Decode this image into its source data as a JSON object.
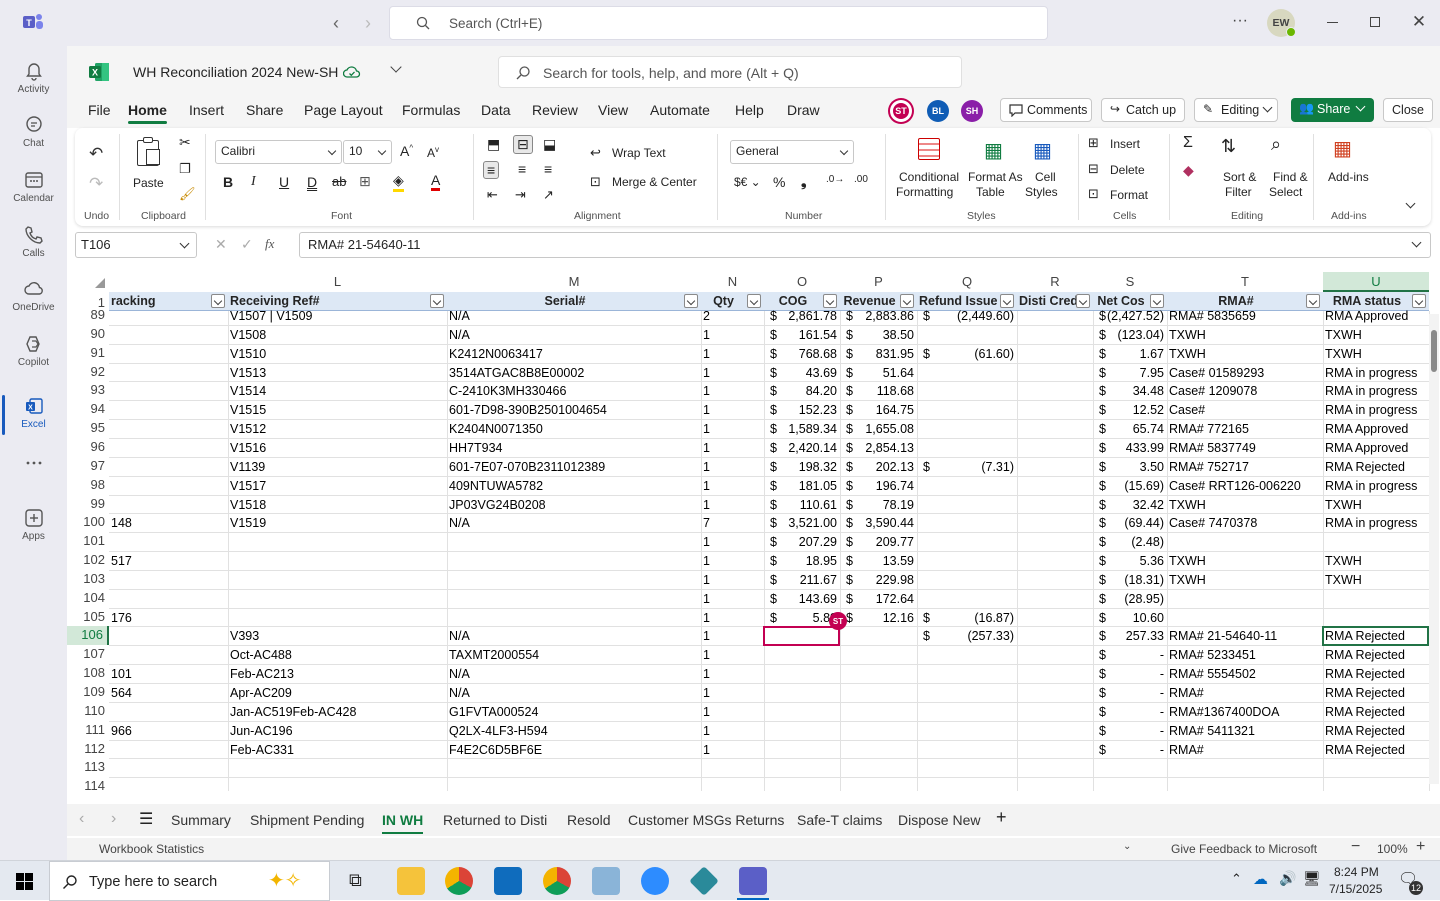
{
  "top": {
    "search_placeholder": "Search (Ctrl+E)",
    "user_initials": "EW"
  },
  "rail": [
    {
      "label": "Activity",
      "icon": "bell-icon"
    },
    {
      "label": "Chat",
      "icon": "chat-icon"
    },
    {
      "label": "Calendar",
      "icon": "calendar-icon"
    },
    {
      "label": "Calls",
      "icon": "phone-icon"
    },
    {
      "label": "OneDrive",
      "icon": "cloud-icon"
    },
    {
      "label": "Copilot",
      "icon": "copilot-icon"
    },
    {
      "label": "Excel",
      "icon": "excel-icon"
    },
    {
      "label": "",
      "icon": "more-icon"
    },
    {
      "label": "Apps",
      "icon": "add-app-icon"
    }
  ],
  "title": {
    "workbook": "WH Reconciliation 2024 New-SH",
    "search_placeholder": "Search for tools, help, and more (Alt + Q)"
  },
  "menu": [
    "File",
    "Home",
    "Insert",
    "Share",
    "Page Layout",
    "Formulas",
    "Data",
    "Review",
    "View",
    "Automate",
    "Help",
    "Draw"
  ],
  "collab": [
    "ST",
    "BL",
    "SH"
  ],
  "actions": {
    "comments": "Comments",
    "catchup": "Catch up",
    "editing": "Editing",
    "share": "Share",
    "close": "Close"
  },
  "ribbon": {
    "undo": "Undo",
    "paste": "Paste",
    "clipboard": "Clipboard",
    "font_name": "Calibri",
    "font_size": "10",
    "font": "Font",
    "wrap": "Wrap Text",
    "merge": "Merge & Center",
    "alignment": "Alignment",
    "number_format": "General",
    "number": "Number",
    "cond": "Conditional",
    "cond2": "Formatting",
    "fmt_table": "Format As",
    "fmt_table2": "Table",
    "cell_styles": "Cell",
    "cell_styles2": "Styles",
    "styles": "Styles",
    "insert": "Insert",
    "delete": "Delete",
    "format": "Format",
    "cells": "Cells",
    "sort": "Sort &",
    "sort2": "Filter",
    "find": "Find &",
    "find2": "Select",
    "editing": "Editing",
    "addins": "Add-ins",
    "addins2": "Add-ins"
  },
  "formula": {
    "name_box": "T106",
    "content": "RMA# 21-54640-11"
  },
  "columns": [
    {
      "letter": "",
      "header": "racking"
    },
    {
      "letter": "L",
      "header": "Receiving Ref#"
    },
    {
      "letter": "M",
      "header": "Serial#"
    },
    {
      "letter": "N",
      "header": "Qty"
    },
    {
      "letter": "O",
      "header": "COG"
    },
    {
      "letter": "P",
      "header": "Revenue"
    },
    {
      "letter": "Q",
      "header": "Refund Issue"
    },
    {
      "letter": "R",
      "header": "Disti Cred"
    },
    {
      "letter": "S",
      "header": "Net Cos"
    },
    {
      "letter": "T",
      "header": "RMA#"
    },
    {
      "letter": "U",
      "header": "RMA status"
    }
  ],
  "rows": [
    {
      "n": "89",
      "k": "",
      "l": "V1507 | V1509",
      "m": "N/A",
      "q": "2",
      "o": "2,861.78",
      "p": "2,883.86",
      "r": "(2,449.60)",
      "s": "(2,427.52)",
      "t": "RMA# 5835659",
      "u": "RMA Approved"
    },
    {
      "n": "90",
      "k": "",
      "l": "V1508",
      "m": "N/A",
      "q": "1",
      "o": "161.54",
      "p": "38.50",
      "r": "",
      "s": "(123.04)",
      "t": "TXWH",
      "u": "TXWH"
    },
    {
      "n": "91",
      "k": "",
      "l": "V1510",
      "m": "K2412N0063417",
      "q": "1",
      "o": "768.68",
      "p": "831.95",
      "r": "(61.60)",
      "s": "1.67",
      "t": "TXWH",
      "u": "TXWH"
    },
    {
      "n": "92",
      "k": "",
      "l": "V1513",
      "m": "3514ATGAC8B8E00002",
      "q": "1",
      "o": "43.69",
      "p": "51.64",
      "r": "",
      "s": "7.95",
      "t": "Case# 01589293",
      "u": "RMA in progress"
    },
    {
      "n": "93",
      "k": "",
      "l": "V1514",
      "m": "C-2410K3MH330466",
      "q": "1",
      "o": "84.20",
      "p": "118.68",
      "r": "",
      "s": "34.48",
      "t": "Case# 1209078",
      "u": "RMA in progress"
    },
    {
      "n": "94",
      "k": "",
      "l": "V1515",
      "m": "601-7D98-390B2501004654",
      "q": "1",
      "o": "152.23",
      "p": "164.75",
      "r": "",
      "s": "12.52",
      "t": "Case#",
      "u": "RMA in progress"
    },
    {
      "n": "95",
      "k": "",
      "l": "V1512",
      "m": "K2404N0071350",
      "q": "1",
      "o": "1,589.34",
      "p": "1,655.08",
      "r": "",
      "s": "65.74",
      "t": "RMA# 772165",
      "u": "RMA Approved"
    },
    {
      "n": "96",
      "k": "",
      "l": "V1516",
      "m": "HH7T934",
      "q": "1",
      "o": "2,420.14",
      "p": "2,854.13",
      "r": "",
      "s": "433.99",
      "t": "RMA# 5837749",
      "u": "RMA Approved"
    },
    {
      "n": "97",
      "k": "",
      "l": "V1139",
      "m": "601-7E07-070B2311012389",
      "q": "1",
      "o": "198.32",
      "p": "202.13",
      "r": "(7.31)",
      "s": "3.50",
      "t": "RMA# 752717",
      "u": "RMA Rejected"
    },
    {
      "n": "98",
      "k": "",
      "l": "V1517",
      "m": "409NTUWA5782",
      "q": "1",
      "o": "181.05",
      "p": "196.74",
      "r": "",
      "s": "(15.69)",
      "t": "Case# RRT126-006220",
      "u": "RMA in progress"
    },
    {
      "n": "99",
      "k": "",
      "l": "V1518",
      "m": "JP03VG24B0208",
      "q": "1",
      "o": "110.61",
      "p": "78.19",
      "r": "",
      "s": "32.42",
      "t": "TXWH",
      "u": "TXWH"
    },
    {
      "n": "100",
      "k": "148",
      "l": "V1519",
      "m": "N/A",
      "q": "7",
      "o": "3,521.00",
      "p": "3,590.44",
      "r": "",
      "s": "(69.44)",
      "t": "Case# 7470378",
      "u": "RMA in progress"
    },
    {
      "n": "101",
      "k": "",
      "l": "",
      "m": "",
      "q": "1",
      "o": "207.29",
      "p": "209.77",
      "r": "",
      "s": "(2.48)",
      "t": "",
      "u": ""
    },
    {
      "n": "102",
      "k": "517",
      "l": "",
      "m": "",
      "q": "1",
      "o": "18.95",
      "p": "13.59",
      "r": "",
      "s": "5.36",
      "t": "TXWH",
      "u": "TXWH"
    },
    {
      "n": "103",
      "k": "",
      "l": "",
      "m": "",
      "q": "1",
      "o": "211.67",
      "p": "229.98",
      "r": "",
      "s": "(18.31)",
      "t": "TXWH",
      "u": "TXWH"
    },
    {
      "n": "104",
      "k": "",
      "l": "",
      "m": "",
      "q": "1",
      "o": "143.69",
      "p": "172.64",
      "r": "",
      "s": "(28.95)",
      "t": "",
      "u": ""
    },
    {
      "n": "105",
      "k": "176",
      "l": "",
      "m": "",
      "q": "1",
      "o": "5.89",
      "p": "12.16",
      "r": "(16.87)",
      "s": "10.60",
      "t": "",
      "u": ""
    },
    {
      "n": "106",
      "k": "",
      "l": "V393",
      "m": "N/A",
      "q": "1",
      "o": "",
      "p": "",
      "r": "(257.33)",
      "s": "257.33",
      "t": "RMA# 21-54640-11",
      "u": "RMA Rejected"
    },
    {
      "n": "107",
      "k": "",
      "l": "Oct-AC488",
      "m": "TAXMT2000554",
      "q": "1",
      "o": "",
      "p": "",
      "r": "",
      "s": "-",
      "t": "RMA# 5233451",
      "u": "RMA Rejected"
    },
    {
      "n": "108",
      "k": "101",
      "l": "Feb-AC213",
      "m": "N/A",
      "q": "1",
      "o": "",
      "p": "",
      "r": "",
      "s": "-",
      "t": "RMA# 5554502",
      "u": "RMA Rejected"
    },
    {
      "n": "109",
      "k": "564",
      "l": "Apr-AC209",
      "m": "N/A",
      "q": "1",
      "o": "",
      "p": "",
      "r": "",
      "s": "-",
      "t": "RMA#",
      "u": "RMA Rejected"
    },
    {
      "n": "110",
      "k": "",
      "l": "Jan-AC519Feb-AC428",
      "m": "G1FVTA000524",
      "q": "1",
      "o": "",
      "p": "",
      "r": "",
      "s": "-",
      "t": "RMA#1367400DOA",
      "u": "RMA Rejected"
    },
    {
      "n": "111",
      "k": "966",
      "l": "Jun-AC196",
      "m": "Q2LX-4LF3-H594",
      "q": "1",
      "o": "",
      "p": "",
      "r": "",
      "s": "-",
      "t": "RMA# 5411321",
      "u": "RMA Rejected"
    },
    {
      "n": "112",
      "k": "",
      "l": "Feb-AC331",
      "m": "F4E2C6D5BF6E",
      "q": "1",
      "o": "",
      "p": "",
      "r": "",
      "s": "-",
      "t": "RMA#",
      "u": "RMA Rejected"
    },
    {
      "n": "113",
      "k": "",
      "l": "",
      "m": "",
      "q": "",
      "o": "",
      "p": "",
      "r": "",
      "s": "",
      "t": "",
      "u": ""
    },
    {
      "n": "114",
      "k": "",
      "l": "",
      "m": "",
      "q": "",
      "o": "",
      "p": "",
      "r": "",
      "s": "",
      "t": "",
      "u": ""
    }
  ],
  "currency_symbol": "$",
  "cursor_badge": "ST",
  "header_row_num": "1",
  "sheets": [
    "Summary",
    "Shipment Pending",
    "IN WH",
    "Returned to Disti",
    "Resold",
    "Customer MSGs Returns",
    "Safe-T claims",
    "Dispose New"
  ],
  "active_sheet": "IN WH",
  "status": {
    "left": "Workbook Statistics",
    "feedback": "Give Feedback to Microsoft",
    "zoom": "100%"
  },
  "taskbar": {
    "search": "Type here to search",
    "time": "8:24 PM",
    "date": "7/15/2025",
    "notif": "12"
  },
  "colors": {
    "excel_green": "#107c41",
    "teams_purple": "#5b5fc7",
    "select_green": "#217346"
  }
}
